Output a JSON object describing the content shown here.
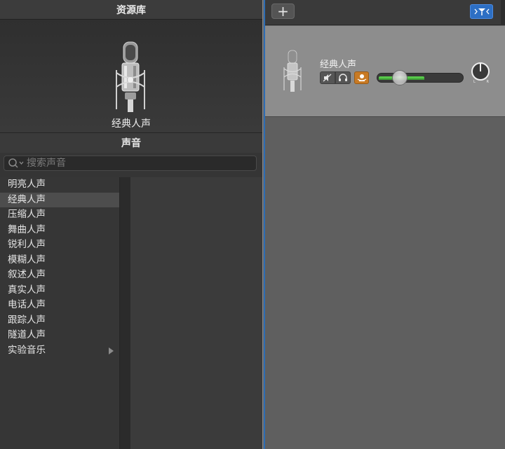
{
  "library": {
    "title": "资源库",
    "preview": {
      "name": "经典人声",
      "icon": "microphone-icon"
    },
    "sounds_header": "声音",
    "search": {
      "placeholder": "搜索声音",
      "icon": "search-icon"
    },
    "items": [
      {
        "label": "明亮人声",
        "selected": false
      },
      {
        "label": "经典人声",
        "selected": true
      },
      {
        "label": "压缩人声",
        "selected": false
      },
      {
        "label": "舞曲人声",
        "selected": false
      },
      {
        "label": "锐利人声",
        "selected": false
      },
      {
        "label": "模糊人声",
        "selected": false
      },
      {
        "label": "叙述人声",
        "selected": false
      },
      {
        "label": "真实人声",
        "selected": false
      },
      {
        "label": "电话人声",
        "selected": false
      },
      {
        "label": "跟踪人声",
        "selected": false
      },
      {
        "label": "隧道人声",
        "selected": false
      },
      {
        "label": "实验音乐",
        "selected": false,
        "has_submenu": true
      }
    ]
  },
  "toolbar": {
    "add_track_label": "+",
    "smart_controls_icon": "smart-controls-icon"
  },
  "track": {
    "name": "经典人声",
    "icon": "microphone-icon",
    "mute_icon": "mute-icon",
    "headphones_icon": "headphones-icon",
    "record_icon": "record-enable-icon",
    "volume_level": 0.2,
    "pan_left": "L",
    "pan_right": "R",
    "colors": {
      "record": "#c87a24",
      "meter": "#57c84a",
      "accent": "#2d6fc4"
    }
  }
}
